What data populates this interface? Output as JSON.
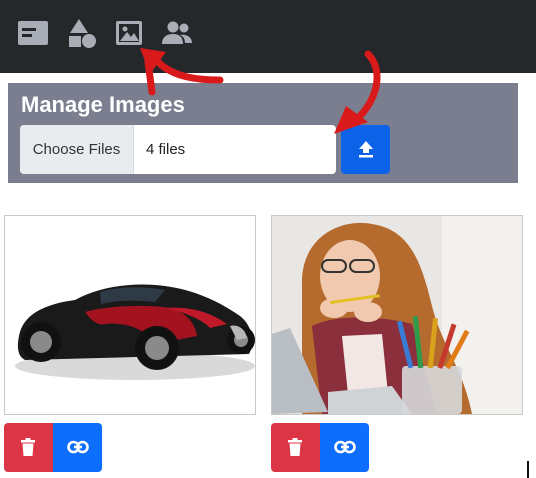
{
  "nav": {
    "items": [
      {
        "icon": "card-icon",
        "active": false
      },
      {
        "icon": "shapes-icon",
        "active": false
      },
      {
        "icon": "image-icon",
        "active": true
      },
      {
        "icon": "users-icon",
        "active": false
      }
    ]
  },
  "manage": {
    "title": "Manage Images",
    "choose_label": "Choose Files",
    "file_status": "4 files",
    "upload_icon": "upload-icon"
  },
  "images": [
    {
      "subject": "car-photo",
      "delete_icon": "trash-icon",
      "link_icon": "link-icon"
    },
    {
      "subject": "woman-studying-photo",
      "delete_icon": "trash-icon",
      "link_icon": "link-icon"
    }
  ],
  "colors": {
    "topbar": "#25272b",
    "panel": "#7a7e8f",
    "primary": "#0d6efd",
    "danger": "#dc3545",
    "annotation_arrow": "#d91a1a"
  }
}
